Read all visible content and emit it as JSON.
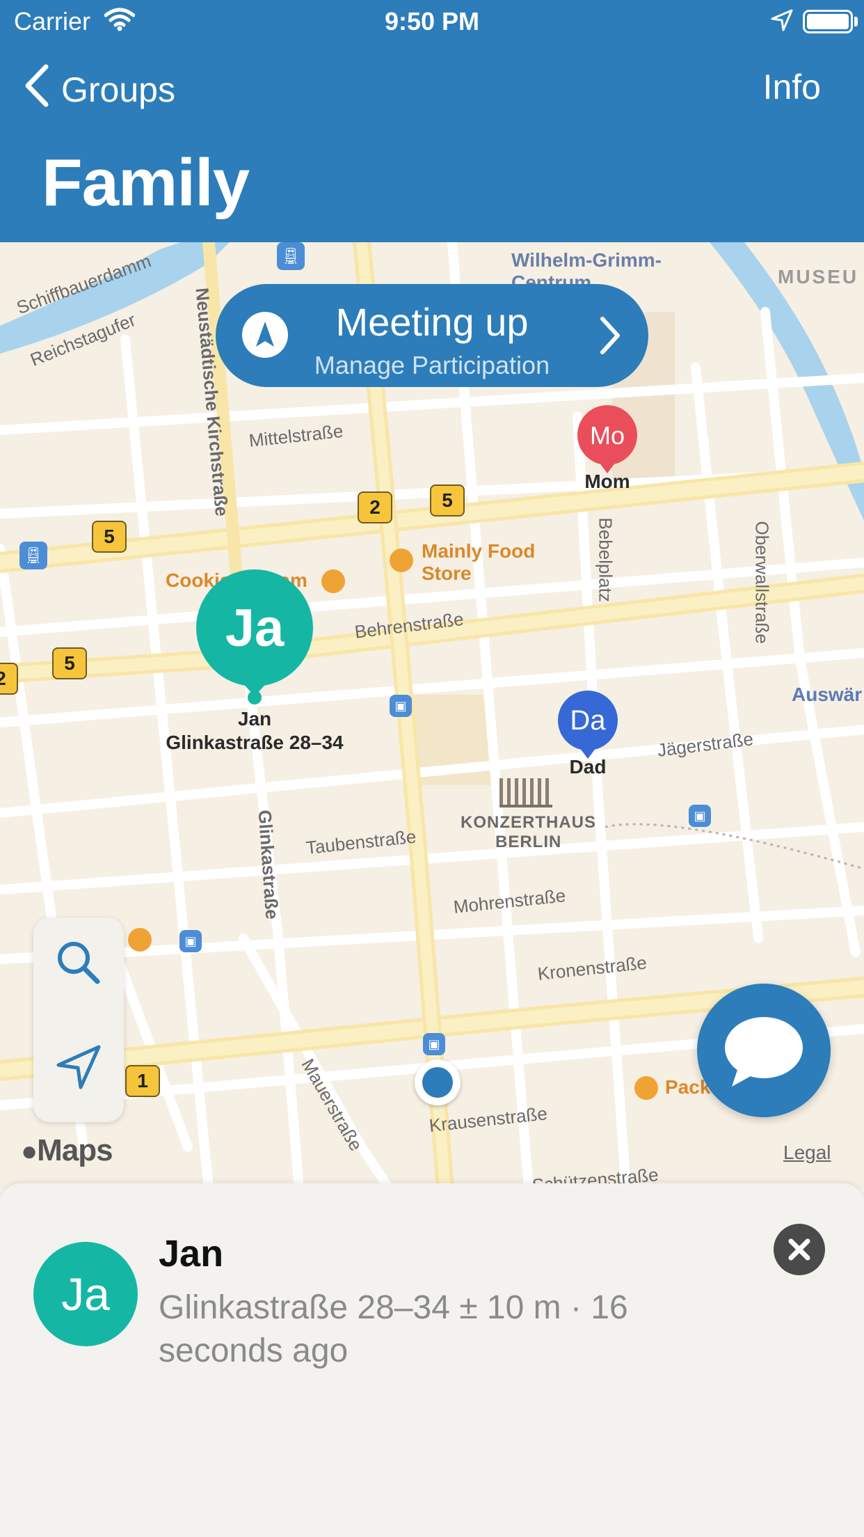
{
  "status_bar": {
    "carrier": "Carrier",
    "time": "9:50 PM"
  },
  "nav": {
    "back_label": "Groups",
    "info_label": "Info",
    "title": "Family"
  },
  "colors": {
    "primary": "#2c7db9",
    "jan": "#15b7a4",
    "mom": "#ea4e5a",
    "dad": "#3668d6"
  },
  "meeting": {
    "title": "Meeting up",
    "subtitle": "Manage Participation"
  },
  "map": {
    "streets": [
      "Schiffbauerdamm",
      "Reichstagufer",
      "Neustädtische Kirchstraße",
      "Mittelstraße",
      "Behrenstraße",
      "Bebelplatz",
      "Oberwallstraße",
      "Jägerstraße",
      "Glinkastraße",
      "Taubenstraße",
      "Mohrenstraße",
      "Kronenstraße",
      "Mauerstraße",
      "Krausenstraße",
      "Schützenstraße"
    ],
    "pois": {
      "wilhelm": "Wilhelm-Grimm-Centrum",
      "museum": "MUSEU",
      "mainly": "Mainly Food Store",
      "cookies": "Cookies Cream",
      "konzerthaus_1": "KONZERTHAUS",
      "konzerthaus_2": "BERLIN",
      "auswaer": "Auswär",
      "pack": "Pack"
    },
    "route_badges": [
      "2",
      "5",
      "5",
      "5",
      "2",
      "1"
    ],
    "attribution": "Maps",
    "legal": "Legal"
  },
  "members": [
    {
      "initials": "Ja",
      "name": "Jan",
      "address": "Glinkastraße 28–34"
    },
    {
      "initials": "Mo",
      "name": "Mom"
    },
    {
      "initials": "Da",
      "name": "Dad"
    }
  ],
  "sheet": {
    "initials": "Ja",
    "name": "Jan",
    "detail": "Glinkastraße 28–34 ± 10 m · 16 seconds ago"
  },
  "icons": [
    "wifi-icon",
    "location-arrow-icon",
    "battery-icon",
    "chevron-left-icon",
    "navigation-icon",
    "chevron-right-icon",
    "search-icon",
    "locate-icon",
    "chat-bubble-icon",
    "close-icon"
  ]
}
